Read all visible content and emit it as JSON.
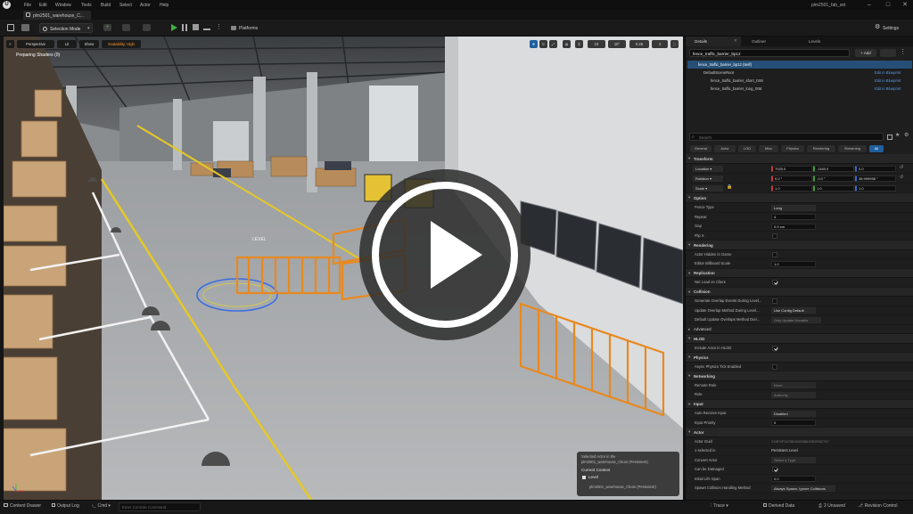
{
  "window": {
    "app_logo": "unreal-engine-logo",
    "menu": [
      "File",
      "Edit",
      "Window",
      "Tools",
      "Build",
      "Select",
      "Actor",
      "Help"
    ],
    "title": "plm2501_fab_set",
    "level_tab": "plm2501_warehouse_C..."
  },
  "toolbar": {
    "selection_mode": "Selection Mode",
    "platforms": "Platforms",
    "settings": "Settings"
  },
  "viewport": {
    "perspective": "Perspective",
    "lit": "Lit",
    "show": "Show",
    "scalability": "Scalability: High",
    "status_text": "Preparing Shaders (0)",
    "grid_values": [
      "10",
      "10°",
      "0.25",
      "4"
    ],
    "world_label": "LEVEL",
    "overlay": {
      "selected_actor_label": "Selected Actor in the",
      "selected_actor_path": "plm2501_warehouse_Clean (Persistent)",
      "current_context": "Current Context",
      "level_label": "Level",
      "level_value": "plm2501_warehouse_Clean (Persistent)"
    }
  },
  "details": {
    "tabs": [
      "Details",
      "Outliner",
      "Levels"
    ],
    "actor_name": "fence_traffic_barrier_bp12",
    "add_label": "+ Add",
    "components": [
      {
        "name": "fence_traffic_barrier_bp12 (Self)",
        "link": ""
      },
      {
        "name": "DefaultSceneRoot",
        "link": "Edit in Blueprint"
      },
      {
        "name": "fence_traffic_barrier_short_ISM",
        "link": "Edit in Blueprint"
      },
      {
        "name": "fence_traffic_barrier_long_ISM",
        "link": "Edit in Blueprint"
      }
    ],
    "search_placeholder": "Search",
    "filter_tabs": [
      "General",
      "Actor",
      "LOD",
      "Misc",
      "Physics",
      "Rendering",
      "Streaming",
      "All"
    ],
    "sections": {
      "transform": "Transform",
      "option": "Option",
      "rendering": "Rendering",
      "replication": "Replication",
      "collision": "Collision",
      "advanced": "Advanced",
      "hlod": "HLOD",
      "physics": "Physics",
      "networking": "Networking",
      "input": "Input",
      "actor": "Actor"
    },
    "transform": {
      "location_label": "Location",
      "rotation_label": "Rotation",
      "scale_label": "Scale",
      "location": [
        "7025.0",
        "-1160.0",
        "0.0"
      ],
      "rotation": [
        "0.0 °",
        "-0.0 °",
        "38.999998 °"
      ],
      "scale": [
        "1.0",
        "1.0",
        "1.0"
      ]
    },
    "option": {
      "fence_type_label": "Fence Type",
      "fence_type_value": "Long",
      "repeat_label": "Repeat",
      "repeat_value": "4",
      "gap_label": "Gap",
      "gap_value": "0.0 cm",
      "flip_label": "Flip X"
    },
    "rendering": {
      "hidden_label": "Actor Hidden In Game",
      "billboard_label": "Editor Billboard Scale",
      "billboard_value": "1.0"
    },
    "replication": {
      "net_load_label": "Net Load on Client"
    },
    "collision": {
      "gen_overlap_label": "Generate Overlap Events During Level...",
      "update_method_label": "Update Overlap Method During Level...",
      "update_method_value": "Use Config Default",
      "default_method_label": "Default Update Overlaps Method Duri...",
      "default_method_value": "Only Update Movable"
    },
    "hlod": {
      "include_label": "Include Actor in HLOD"
    },
    "physics": {
      "async_label": "Async Physics Tick Enabled"
    },
    "networking": {
      "remote_role_label": "Remote Role",
      "remote_role_value": "None",
      "role_label": "Role",
      "role_value": "Authority"
    },
    "input": {
      "auto_receive_label": "Auto Receive Input",
      "auto_receive_value": "Disabled",
      "priority_label": "Input Priority",
      "priority_value": "0"
    },
    "actor": {
      "guid_label": "Actor Guid",
      "guid_value": "21BF0F3475626493B639E6F8E747",
      "selected_label": "1 selected in",
      "selected_value": "Persistent Level",
      "convert_label": "Convert Actor",
      "convert_value": "Select a Type",
      "damaged_label": "Can be Damaged",
      "lifespan_label": "Initial Life Span",
      "lifespan_value": "0.0",
      "spawn_label": "Spawn Collision Handling Method",
      "spawn_value": "Always Spawn, Ignore Collisions"
    }
  },
  "statusbar": {
    "content_drawer": "Content Drawer",
    "output_log": "Output Log",
    "cmd": "Cmd",
    "console_placeholder": "Enter Console Command",
    "trace": "Trace",
    "derived_data": "Derived Data",
    "unsaved": "2 Unsaved",
    "revision": "Revision Control"
  },
  "colors": {
    "accent_blue": "#1f5f9e",
    "play_green": "#3fae3f",
    "barrier_orange": "#e8891e",
    "selected_row": "#264f78"
  }
}
